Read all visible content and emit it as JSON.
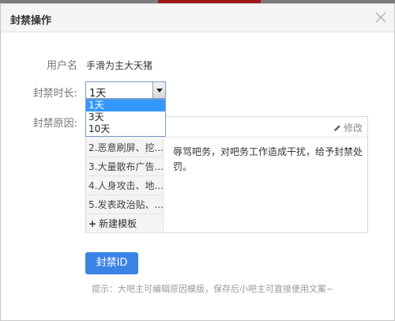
{
  "dialog": {
    "title": "封禁操作"
  },
  "form": {
    "username_label": "用户名",
    "username_value": "手滑为主大天猪",
    "duration_label": "封禁时长:",
    "duration_selected": "1天",
    "duration_options": [
      "1天",
      "3天",
      "10天"
    ],
    "reason_label": "封禁原因:",
    "edit_label": "修改",
    "templates": [
      "2.恶意刷屏、挖...",
      "3.大量散布广告...",
      "4.人身攻击、地...",
      "5.发表政治贴、..."
    ],
    "new_template_label": "新建模板",
    "reason_text": "辱骂吧务，对吧务工作造成干扰，给予封禁处罚。",
    "submit_label": "封禁ID",
    "tip": "提示：大吧主可编辑原因模版，保存后小吧主可直接使用文案~"
  },
  "colors": {
    "accent": "#3a83e6",
    "selected_option": "#3399ff"
  }
}
